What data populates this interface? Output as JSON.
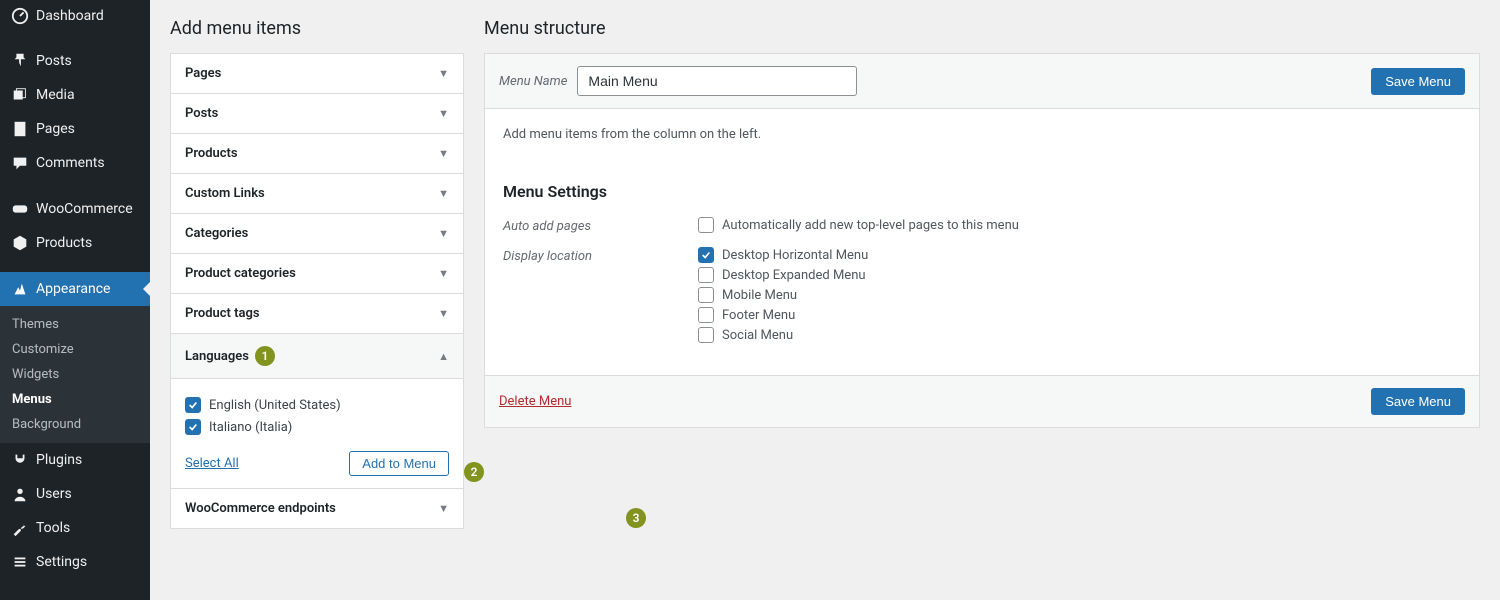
{
  "sidebar": {
    "items": [
      {
        "label": "Dashboard"
      },
      {
        "label": "Posts"
      },
      {
        "label": "Media"
      },
      {
        "label": "Pages"
      },
      {
        "label": "Comments"
      },
      {
        "label": "WooCommerce"
      },
      {
        "label": "Products"
      },
      {
        "label": "Appearance"
      },
      {
        "label": "Plugins"
      },
      {
        "label": "Users"
      },
      {
        "label": "Tools"
      },
      {
        "label": "Settings"
      }
    ],
    "sub": [
      "Themes",
      "Customize",
      "Widgets",
      "Menus",
      "Background"
    ]
  },
  "add": {
    "title": "Add menu items",
    "accordions": [
      "Pages",
      "Posts",
      "Products",
      "Custom Links",
      "Categories",
      "Product categories",
      "Product tags",
      "Languages",
      "WooCommerce endpoints"
    ],
    "languages": [
      "English (United States)",
      "Italiano (Italia)"
    ],
    "select_all": "Select All",
    "add_to_menu": "Add to Menu"
  },
  "structure": {
    "title": "Menu structure",
    "menu_name_label": "Menu Name",
    "menu_name_value": "Main Menu",
    "save_btn": "Save Menu",
    "hint": "Add menu items from the column on the left.",
    "settings_title": "Menu Settings",
    "auto_add_label": "Auto add pages",
    "auto_add_option": "Automatically add new top-level pages to this menu",
    "display_label": "Display location",
    "display_options": [
      "Desktop Horizontal Menu",
      "Desktop Expanded Menu",
      "Mobile Menu",
      "Footer Menu",
      "Social Menu"
    ],
    "delete": "Delete Menu"
  },
  "badges": {
    "one": "1",
    "two": "2",
    "three": "3"
  }
}
